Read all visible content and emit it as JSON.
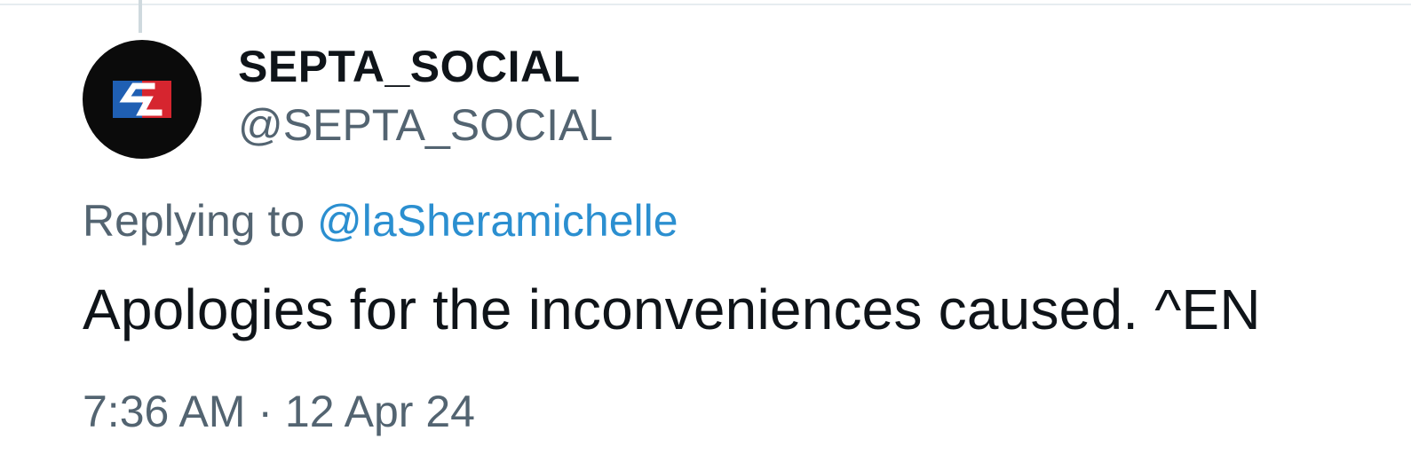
{
  "author": {
    "display_name": "SEPTA_SOCIAL",
    "handle": "@SEPTA_SOCIAL",
    "avatar_icon": "septa-logo-icon"
  },
  "reply": {
    "prefix": "Replying to ",
    "mention": "@laSheramichelle"
  },
  "tweet": {
    "text": "Apologies for the inconveniences caused. ^EN"
  },
  "meta": {
    "time": "7:36 AM",
    "separator": " · ",
    "date": "12 Apr 24"
  },
  "colors": {
    "primary_text": "#0f1419",
    "secondary_text": "#536471",
    "link": "#2b8fd0",
    "logo_blue": "#1f5fb3",
    "logo_red": "#d6252f"
  }
}
